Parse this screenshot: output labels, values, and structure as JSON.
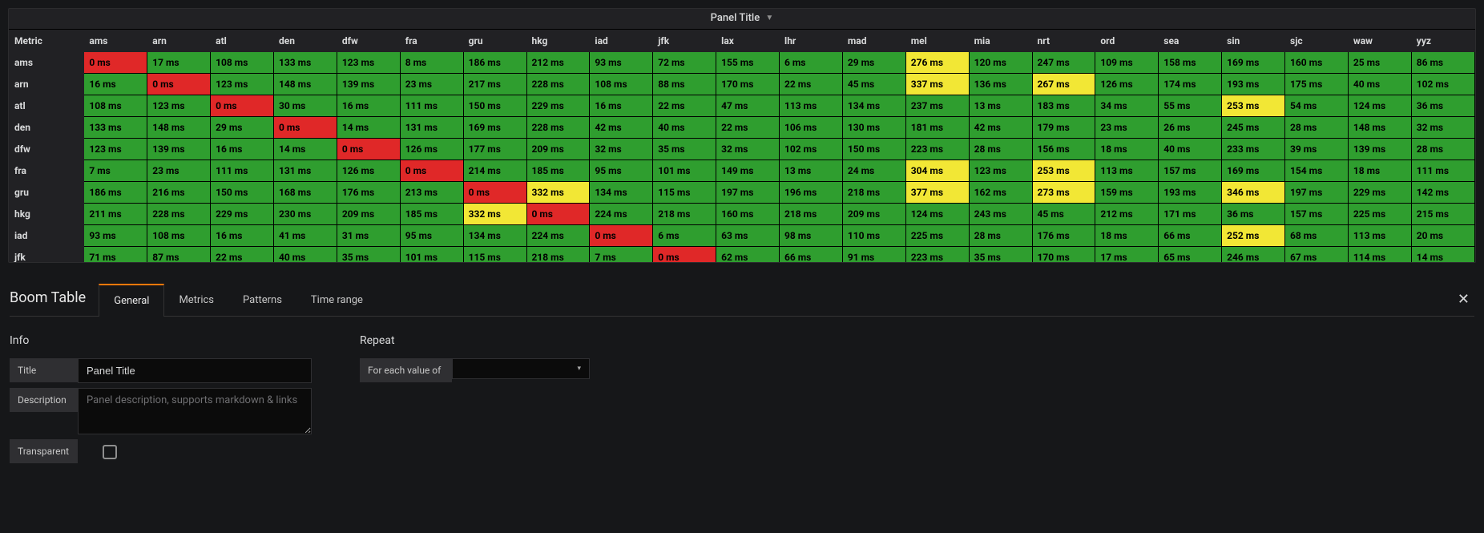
{
  "panel": {
    "title": "Panel Title",
    "metric_header": "Metric",
    "columns": [
      "ams",
      "arn",
      "atl",
      "den",
      "dfw",
      "fra",
      "gru",
      "hkg",
      "iad",
      "jfk",
      "lax",
      "lhr",
      "mad",
      "mel",
      "mia",
      "nrt",
      "ord",
      "sea",
      "sin",
      "sjc",
      "waw",
      "yyz"
    ],
    "row_labels": [
      "ams",
      "arn",
      "atl",
      "den",
      "dfw",
      "fra",
      "gru",
      "hkg",
      "iad",
      "jfk"
    ],
    "matrix_ms": [
      [
        0,
        17,
        108,
        133,
        123,
        8,
        186,
        212,
        93,
        72,
        155,
        6,
        29,
        276,
        120,
        247,
        109,
        158,
        169,
        160,
        25,
        86
      ],
      [
        16,
        0,
        123,
        148,
        139,
        23,
        217,
        228,
        108,
        88,
        170,
        22,
        45,
        337,
        136,
        267,
        126,
        174,
        193,
        175,
        40,
        102
      ],
      [
        108,
        123,
        0,
        30,
        16,
        111,
        150,
        229,
        16,
        22,
        47,
        113,
        134,
        237,
        13,
        183,
        34,
        55,
        253,
        54,
        124,
        36
      ],
      [
        133,
        148,
        29,
        0,
        14,
        131,
        169,
        228,
        42,
        40,
        22,
        106,
        130,
        181,
        42,
        179,
        23,
        26,
        245,
        28,
        148,
        32
      ],
      [
        123,
        139,
        16,
        14,
        0,
        126,
        177,
        209,
        32,
        35,
        32,
        102,
        150,
        223,
        28,
        156,
        18,
        40,
        233,
        39,
        139,
        28
      ],
      [
        7,
        23,
        111,
        131,
        126,
        0,
        214,
        185,
        95,
        101,
        149,
        13,
        24,
        304,
        123,
        253,
        113,
        157,
        169,
        154,
        18,
        111
      ],
      [
        186,
        216,
        150,
        168,
        176,
        213,
        0,
        332,
        134,
        115,
        197,
        196,
        218,
        377,
        162,
        273,
        159,
        193,
        346,
        197,
        229,
        142
      ],
      [
        211,
        228,
        229,
        230,
        209,
        185,
        332,
        0,
        224,
        218,
        160,
        218,
        209,
        124,
        243,
        45,
        212,
        171,
        36,
        157,
        225,
        215
      ],
      [
        93,
        108,
        16,
        41,
        31,
        95,
        134,
        224,
        0,
        6,
        63,
        98,
        110,
        225,
        28,
        176,
        18,
        66,
        252,
        68,
        113,
        20
      ],
      [
        71,
        87,
        22,
        40,
        35,
        101,
        115,
        218,
        7,
        0,
        62,
        66,
        91,
        223,
        35,
        170,
        17,
        65,
        246,
        67,
        114,
        14
      ]
    ],
    "unit": "ms",
    "thresholds": {
      "yellow_min": 250,
      "red_at": 0,
      "red_min": 400
    }
  },
  "editor": {
    "plugin_name": "Boom Table",
    "tabs": [
      "General",
      "Metrics",
      "Patterns",
      "Time range"
    ],
    "active_tab": 0,
    "close_symbol": "✕",
    "info_section": {
      "heading": "Info",
      "title_label": "Title",
      "title_value": "Panel Title",
      "description_label": "Description",
      "description_placeholder": "Panel description, supports markdown & links",
      "description_value": "",
      "transparent_label": "Transparent",
      "transparent_checked": false
    },
    "repeat_section": {
      "heading": "Repeat",
      "for_each_label": "For each value of",
      "selected_value": ""
    }
  }
}
